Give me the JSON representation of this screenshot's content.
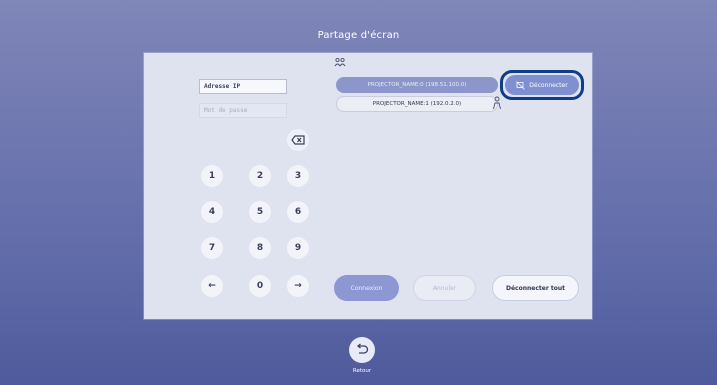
{
  "screen": {
    "title": "Partage d'écran"
  },
  "form": {
    "ip_placeholder": "Adresse IP",
    "password_placeholder": "Mot de passe"
  },
  "keypad": {
    "keys": [
      "1",
      "2",
      "3",
      "4",
      "5",
      "6",
      "7",
      "8",
      "9",
      "0"
    ],
    "backspace_icon": "backspace-icon",
    "left_arrow": "←",
    "right_arrow": "→"
  },
  "projectors": {
    "icon": "people-icon",
    "items": [
      {
        "label": "PROJECTOR_NAME:0  (198.51.100.0)",
        "state": "connected"
      },
      {
        "label": "PROJECTOR_NAME:1  (192.0.2.0)",
        "state": "available"
      }
    ],
    "disconnect_label": "Déconnecter"
  },
  "actions": {
    "connect": "Connexion",
    "cancel": "Annuler",
    "disconnect_all": "Déconnecter tout"
  },
  "footer": {
    "back_label": "Retour"
  },
  "colors": {
    "background": "#5f6aa8",
    "panel": "#dfe2ef",
    "accent": "#7f8fd0",
    "focus_ring": "#0f3d8a"
  }
}
